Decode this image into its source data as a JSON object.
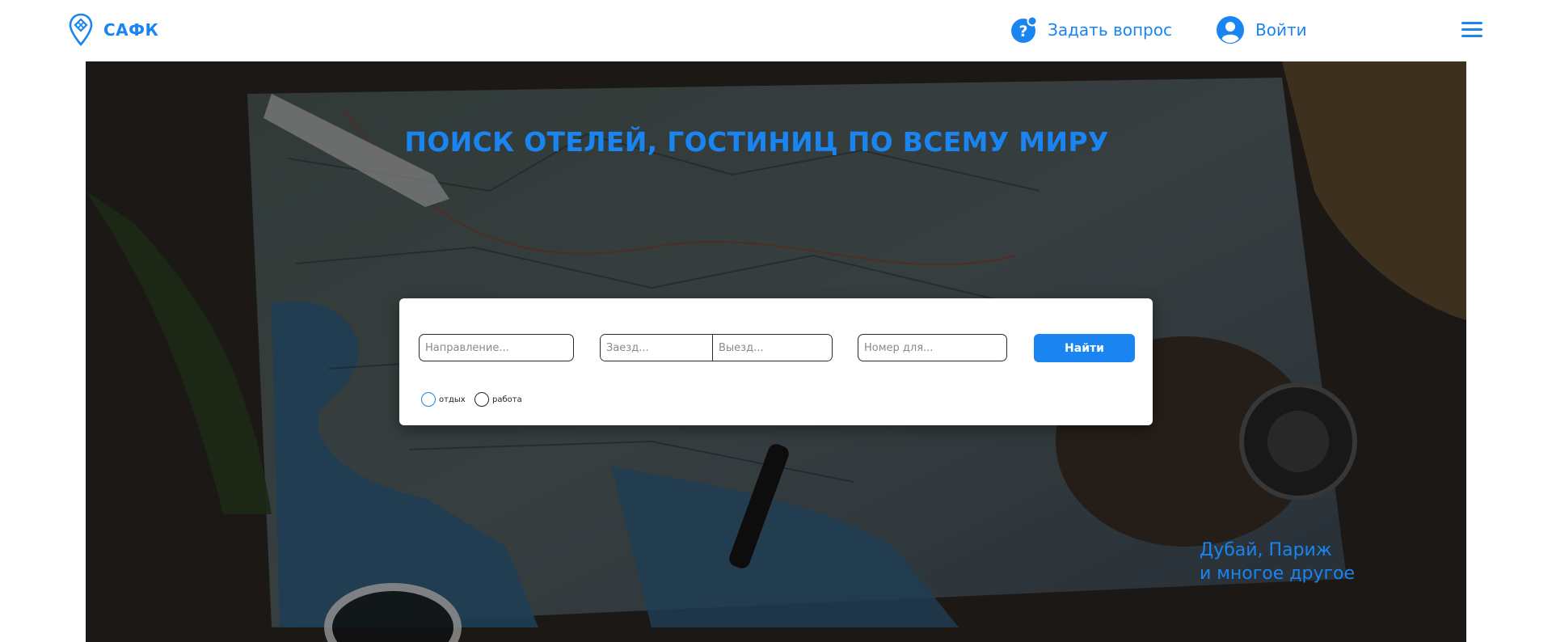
{
  "header": {
    "brand": "САФК",
    "ask_label": "Задать вопрос",
    "login_label": "Войти"
  },
  "hero": {
    "title": "ПОИСК ОТЕЛЕЙ, ГОСТИНИЦ ПО ВСЕМУ МИРУ",
    "promo_line1": "Дубай, Париж",
    "promo_line2": "и многое другое"
  },
  "search": {
    "destination_placeholder": "Направление...",
    "checkin_placeholder": "Заезд...",
    "checkout_placeholder": "Выезд...",
    "room_placeholder": "Номер для...",
    "submit_label": "Найти",
    "purpose_options": [
      "отдых",
      "работа"
    ]
  },
  "colors": {
    "accent": "#1a84f0",
    "panel": "#ffffff",
    "overlay": "#1f2326"
  },
  "icons": {
    "logo": "map-pin-logo-icon",
    "ask": "question-bubble-icon",
    "login": "user-circle-icon",
    "menu": "hamburger-menu-icon"
  }
}
